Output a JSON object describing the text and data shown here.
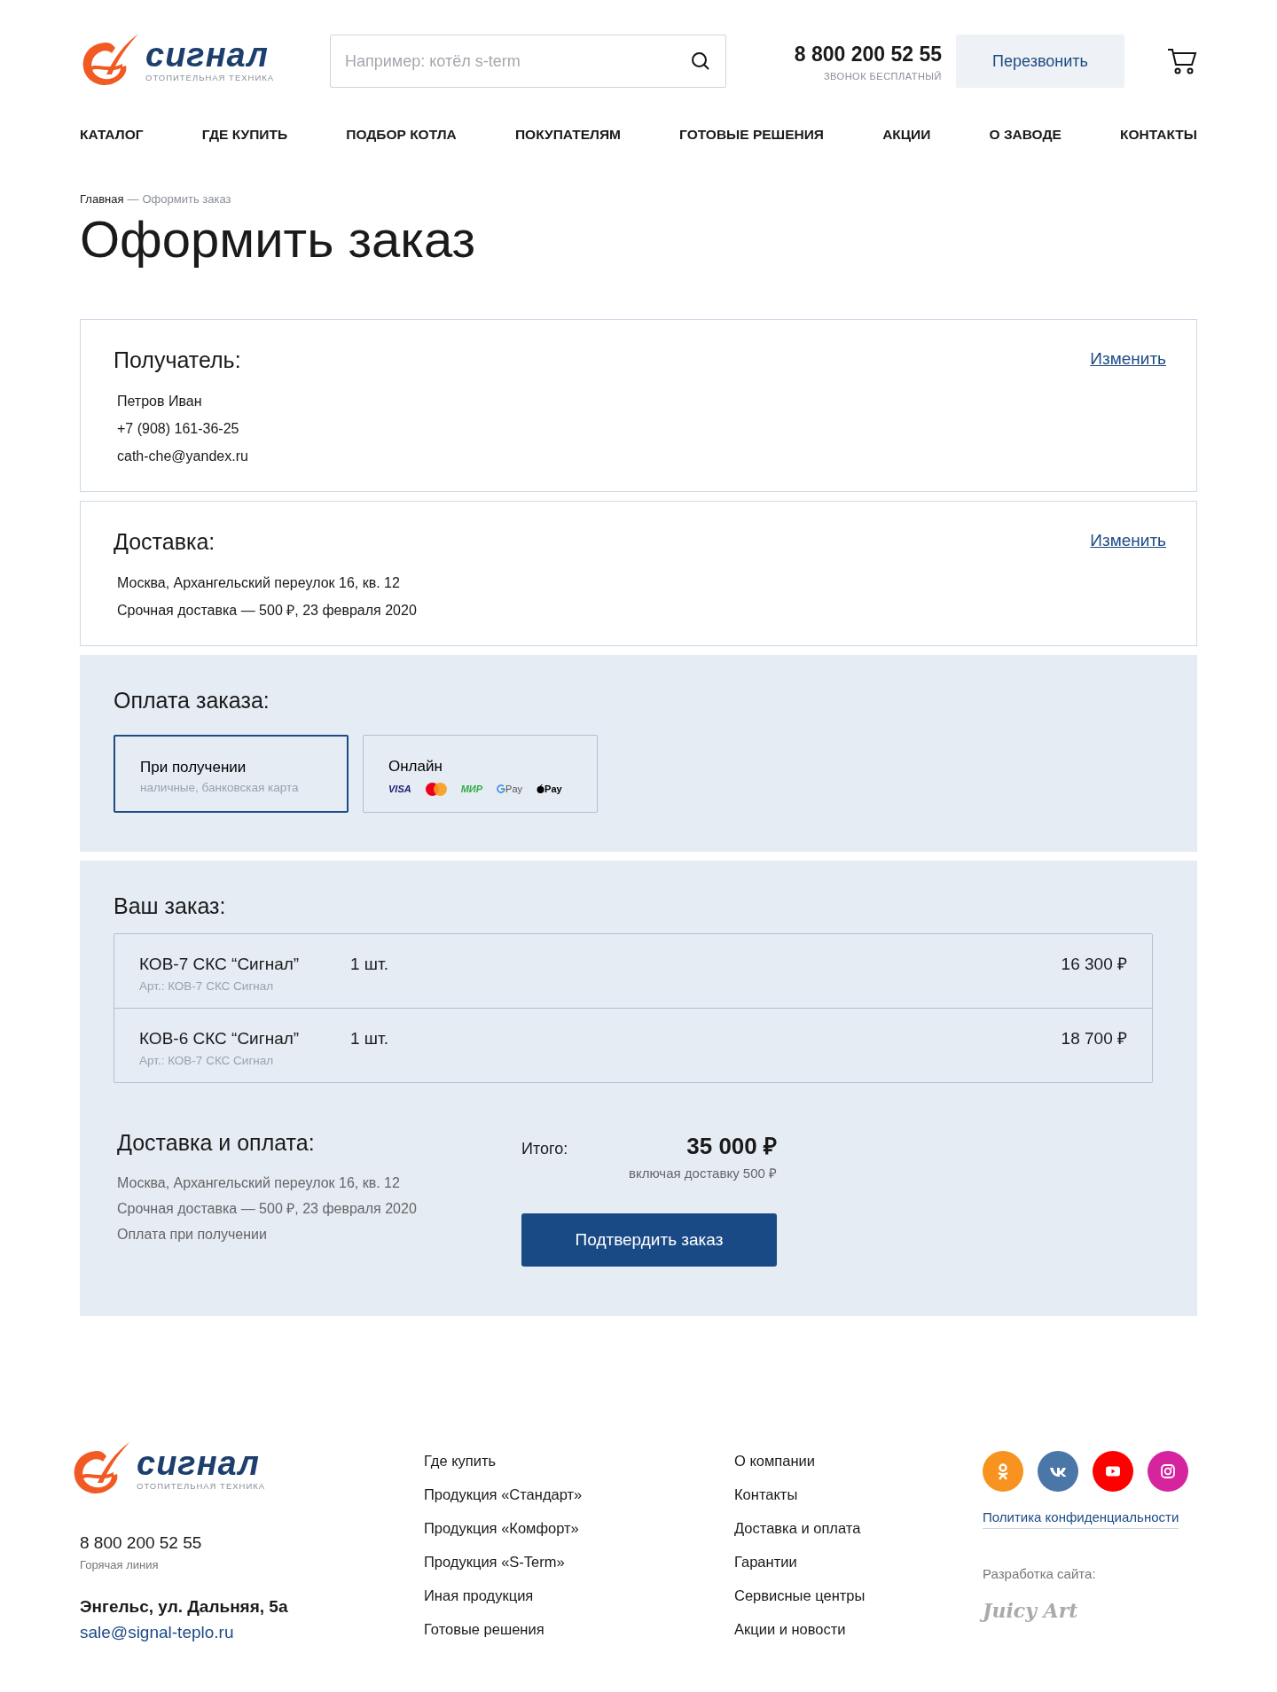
{
  "header": {
    "logo": {
      "name": "сигнал",
      "tagline": "ОТОПИТЕЛЬНАЯ ТЕХНИКА"
    },
    "search": {
      "placeholder": "Например: котёл s-term"
    },
    "phone": "8 800 200 52 55",
    "phone_note": "ЗВОНОК БЕСПЛАТНЫЙ",
    "callback_button": "Перезвонить"
  },
  "nav": [
    "КАТАЛОГ",
    "ГДЕ КУПИТЬ",
    "ПОДБОР КОТЛА",
    "ПОКУПАТЕЛЯМ",
    "ГОТОВЫЕ РЕШЕНИЯ",
    "АКЦИИ",
    "О ЗАВОДЕ",
    "КОНТАКТЫ"
  ],
  "breadcrumb": {
    "link": "Главная",
    "separator": "—",
    "current": "Оформить заказ"
  },
  "title": "Оформить заказ",
  "recipient": {
    "heading": "Получатель:",
    "edit": "Изменить",
    "lines": [
      "Петров Иван",
      "+7 (908) 161-36-25",
      "cath-che@yandex.ru"
    ]
  },
  "delivery": {
    "heading": "Доставка:",
    "edit": "Изменить",
    "lines": [
      "Москва, Архангельский переулок 16, кв. 12",
      "Срочная доставка — 500 ₽, 23 февраля 2020"
    ]
  },
  "payment": {
    "heading": "Оплата заказа:",
    "options": [
      {
        "title": "При получении",
        "subtitle": "наличные, банковская карта",
        "selected": true
      },
      {
        "title": "Онлайн",
        "selected": false,
        "marks": [
          {
            "kind": "visa",
            "text": "VISA"
          },
          {
            "kind": "mastercard"
          },
          {
            "kind": "mir",
            "text": "МИР"
          },
          {
            "kind": "gpay",
            "text": "Pay"
          },
          {
            "kind": "applepay",
            "text": "Pay"
          }
        ]
      }
    ]
  },
  "order": {
    "heading": "Ваш заказ:",
    "items": [
      {
        "name": "КОВ-7 СКС “Сигнал”",
        "sku": "Арт.: КОВ-7 СКС Сигнал",
        "qty": "1 шт.",
        "price": "16 300 ₽"
      },
      {
        "name": "КОВ-6 СКС “Сигнал”",
        "sku": "Арт.: КОВ-7 СКС Сигнал",
        "qty": "1 шт.",
        "price": "18 700 ₽"
      }
    ],
    "summary_heading": "Доставка и оплата:",
    "summary_lines": [
      "Москва, Архангельский переулок 16, кв. 12",
      "Срочная доставка — 500 ₽, 23 февраля 2020",
      "Оплата при получении"
    ],
    "total_label": "Итого:",
    "total": "35 000 ₽",
    "total_note": "включая доставку 500 ₽",
    "confirm_button": "Подтвердить заказ"
  },
  "footer": {
    "logo": {
      "name": "сигнал",
      "tagline": "ОТОПИТЕЛЬНАЯ ТЕХНИКА"
    },
    "phone": "8 800 200 52 55",
    "phone_note": "Горячая линия",
    "address": "Энгельс, ул. Дальняя, 5а",
    "email": "sale@signal-teplo.ru",
    "links_1": [
      "Где купить",
      "Продукция «Стандарт»",
      "Продукция «Комфорт»",
      "Продукция «S-Term»",
      "Иная продукция",
      "Готовые решения"
    ],
    "links_2": [
      "О компании",
      "Контакты",
      "Доставка и оплата",
      "Гарантии",
      "Сервисные центры",
      "Акции и новости"
    ],
    "socials": [
      {
        "kind": "ok",
        "color": "#f7931e"
      },
      {
        "kind": "vk",
        "color": "#4a76a8"
      },
      {
        "kind": "youtube",
        "color": "#ff0000"
      },
      {
        "kind": "instagram",
        "color": "#d6249f"
      }
    ],
    "privacy": "Политика конфиденциальности",
    "dev_label": "Разработка сайта:",
    "dev_logo": "Juicy Art"
  }
}
